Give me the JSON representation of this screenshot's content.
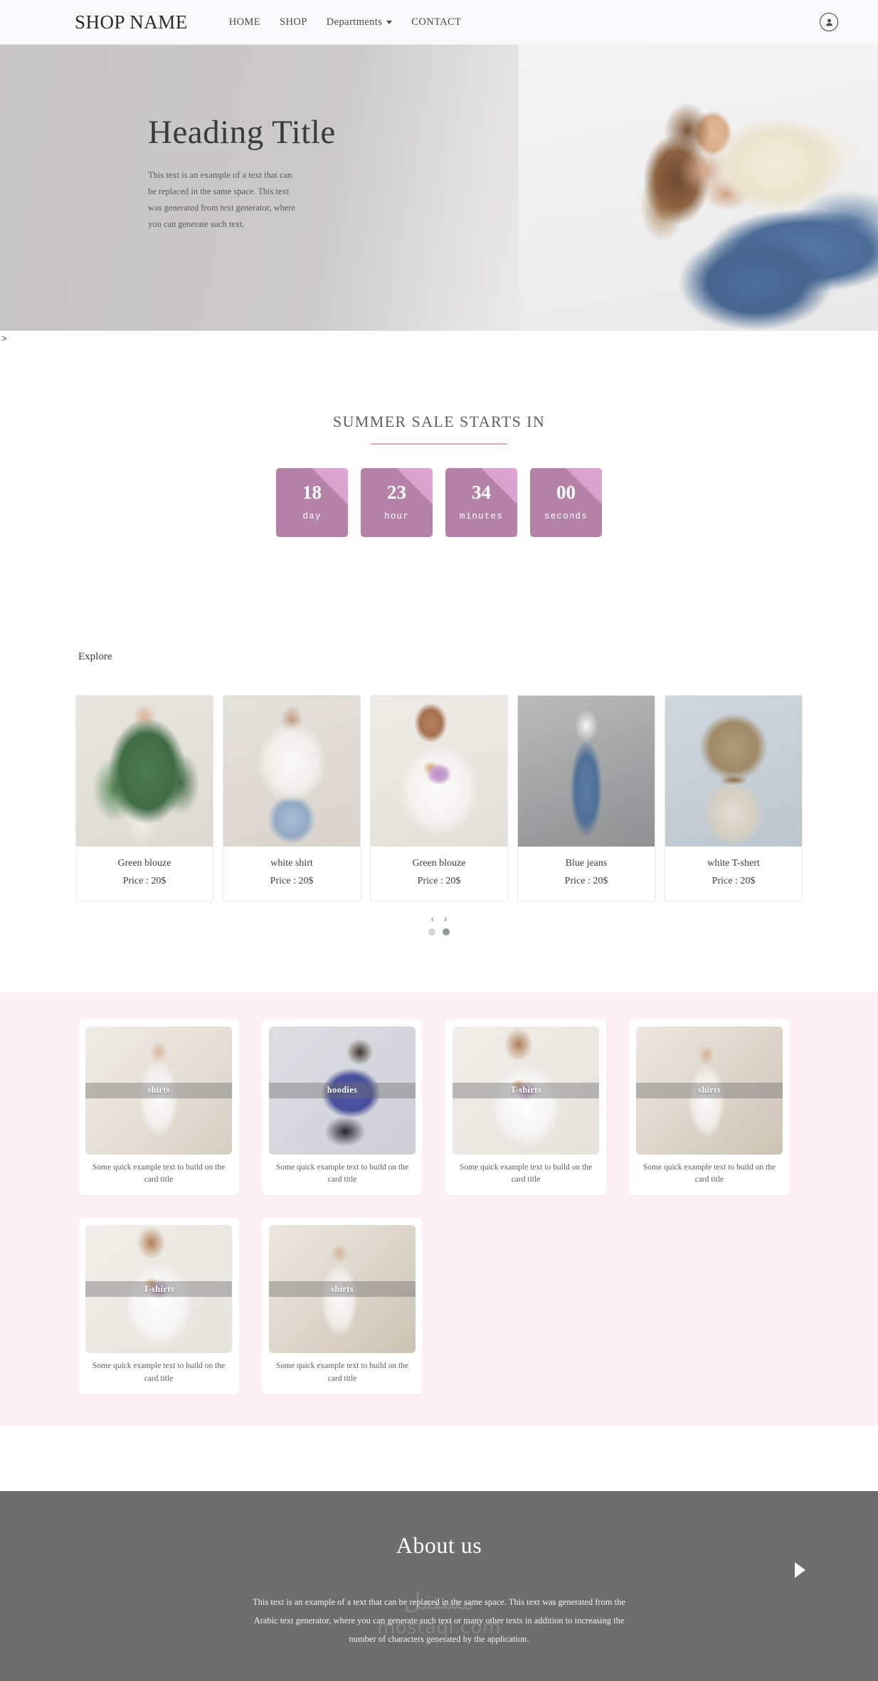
{
  "navbar": {
    "brand": "SHOP NAME",
    "links": [
      {
        "label": "HOME"
      },
      {
        "label": "SHOP"
      },
      {
        "label": "Departments",
        "dropdown": true
      },
      {
        "label": "CONTACT"
      }
    ],
    "account_icon": "user-account-icon"
  },
  "hero": {
    "title": "Heading Title",
    "description": "This text is an example of a text that can be replaced in the same space. This text was generated from text generator, where you can generate such text.",
    "chevron": ">",
    "photo_alt": "woman-in-cream-top-and-blue-jeans"
  },
  "countdown": {
    "heading": "SUMMER SALE STARTS IN",
    "boxes": [
      {
        "value": "18",
        "label": "day"
      },
      {
        "value": "23",
        "label": "hour"
      },
      {
        "value": "34",
        "label": "minutes"
      },
      {
        "value": "00",
        "label": "seconds"
      }
    ],
    "box_color": "#b382a6",
    "box_accent_color": "#d9a3cd",
    "rule_color": "#d9a9bd"
  },
  "explore": {
    "title": "Explore",
    "products": [
      {
        "name": "Green blouze",
        "price": "Price : 20$",
        "image": "green-blouze"
      },
      {
        "name": "white shirt",
        "price": "Price : 20$",
        "image": "white-shirt"
      },
      {
        "name": "Green blouze",
        "price": "Price : 20$",
        "image": "tee-floral"
      },
      {
        "name": "Blue jeans",
        "price": "Price : 20$",
        "image": "blue-jeans"
      },
      {
        "name": "white T-shert",
        "price": "Price : 20$",
        "image": "khaki-shirt"
      }
    ],
    "prev_arrow": "‹",
    "next_arrow": "›",
    "dots": [
      {
        "active": false
      },
      {
        "active": true
      }
    ]
  },
  "categories": {
    "background_color": "#fdf0f5",
    "cards": [
      {
        "label": "shirts",
        "caption": "Some quick example text to build on the card title",
        "image": "shirts-a"
      },
      {
        "label": "hoodies",
        "caption": "Some quick example text to build on the card title",
        "image": "hoodies"
      },
      {
        "label": "T-shirts",
        "caption": "Some quick example text to build on the card title",
        "image": "tshirts"
      },
      {
        "label": "shirts",
        "caption": "Some quick example text to build on the card title",
        "image": "shirts-b"
      },
      {
        "label": "T-shirts",
        "caption": "Some quick example text to build on the card title",
        "image": "tshirts"
      },
      {
        "label": "shirts",
        "caption": "Some quick example text to build on the card title",
        "image": "shirts-b"
      }
    ]
  },
  "about": {
    "title": "About us",
    "text": "This text is an example of a text that can be replaced in the same space. This text was generated from the Arabic text generator, where you can generate such text or many other texts in addition to increasing the number of characters generated by the application.",
    "background_color": "#6e6e6e",
    "next_arrow_icon": "play-triangle-icon",
    "watermark_glyph": "مستقل",
    "watermark_domain": "mostaql.com"
  }
}
